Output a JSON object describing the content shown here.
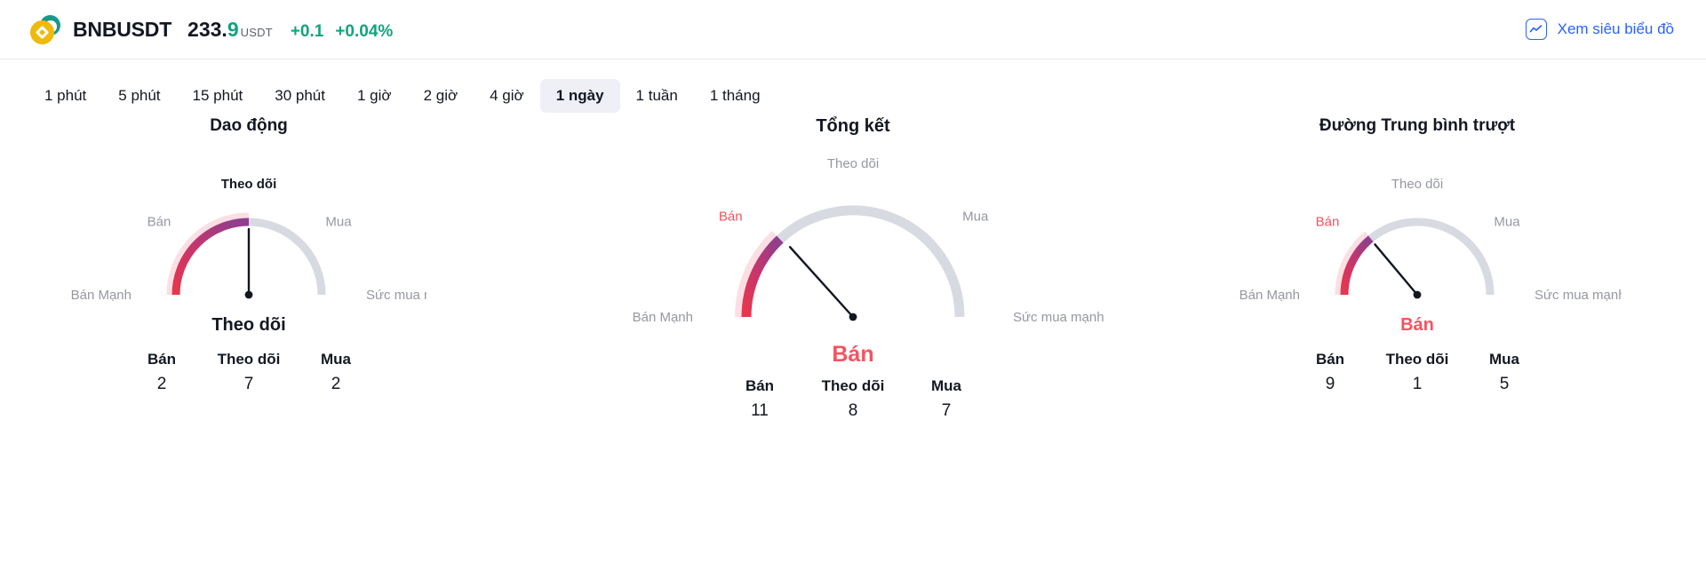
{
  "header": {
    "coin_icon": "binance-coin-icon",
    "symbol": "BNBUSDT",
    "price": "233.",
    "price_fraction": "9",
    "price_unit": "USDT",
    "change_abs": "+0.1",
    "change_pct": "+0.04%",
    "accent_green": "#13a37f",
    "superchart_label": "Xem siêu biểu đồ",
    "superchart_icon": "line-chart-icon",
    "link_color": "#2962ff"
  },
  "tabs": {
    "items": [
      {
        "label": "1 phút",
        "active": false
      },
      {
        "label": "5 phút",
        "active": false
      },
      {
        "label": "15 phút",
        "active": false
      },
      {
        "label": "30 phút",
        "active": false
      },
      {
        "label": "1 giờ",
        "active": false
      },
      {
        "label": "2 giờ",
        "active": false
      },
      {
        "label": "4 giờ",
        "active": false
      },
      {
        "label": "1 ngày",
        "active": true
      },
      {
        "label": "1 tuần",
        "active": false
      },
      {
        "label": "1 tháng",
        "active": false
      }
    ]
  },
  "scale_labels": {
    "strong_sell": "Bán Mạnh",
    "sell": "Bán",
    "neutral": "Theo dõi",
    "buy": "Mua",
    "strong_buy": "Sức mua mạnh"
  },
  "colors": {
    "sell_red": "#f7525f",
    "arc_red": "#e8374c",
    "arc_purple": "#8e3f8e",
    "arc_crimson": "#c9356a",
    "arc_gray": "#d8dae2",
    "arc_pink_halo": "#fbdfe4",
    "needle": "#131722"
  },
  "chart_data": [
    {
      "type": "gauge",
      "title": "Dao động",
      "index": 0,
      "result": "Theo dõi",
      "result_state": "neutral",
      "needle_angle_deg": 0,
      "arc_fill_fraction": 0.5,
      "active_label": "Theo dõi",
      "axis_labels": [
        "Bán Mạnh",
        "Bán",
        "Theo dõi",
        "Mua",
        "Sức mua mạnh"
      ],
      "categories": [
        "Bán",
        "Theo dõi",
        "Mua"
      ],
      "values": [
        2,
        7,
        2
      ]
    },
    {
      "type": "gauge",
      "title": "Tổng kết",
      "index": 1,
      "result": "Bán",
      "result_state": "sell",
      "needle_angle_deg": -42,
      "arc_fill_fraction": 0.26,
      "active_label": "Bán",
      "axis_labels": [
        "Bán Mạnh",
        "Bán",
        "Theo dõi",
        "Mua",
        "Sức mua mạnh"
      ],
      "categories": [
        "Bán",
        "Theo dõi",
        "Mua"
      ],
      "values": [
        11,
        8,
        7
      ]
    },
    {
      "type": "gauge",
      "title": "Đường Trung bình trượt",
      "index": 2,
      "result": "Bán",
      "result_state": "sell",
      "needle_angle_deg": -40,
      "arc_fill_fraction": 0.28,
      "active_label": "Bán",
      "axis_labels": [
        "Bán Mạnh",
        "Bán",
        "Theo dõi",
        "Mua",
        "Sức mua mạnh"
      ],
      "categories": [
        "Bán",
        "Theo dõi",
        "Mua"
      ],
      "values": [
        9,
        1,
        5
      ]
    }
  ]
}
